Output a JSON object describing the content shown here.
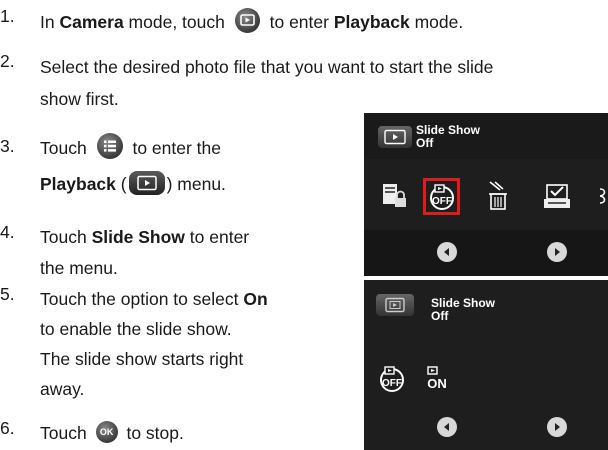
{
  "steps": [
    {
      "num": "1.",
      "pre": "In ",
      "b1": "Camera",
      "mid": " mode, touch",
      "post": "to enter ",
      "b2": "Playback",
      "end": " mode."
    },
    {
      "num": "2.",
      "line1": "Select the desired photo file that you want to start the slide",
      "line2": "show first."
    },
    {
      "num": "3.",
      "pre": "Touch",
      "post": "to enter the",
      "b1": "Playback",
      "paren_open": " (",
      "paren_close": ") menu."
    },
    {
      "num": "4.",
      "pre": "Touch ",
      "b1": "Slide Show",
      "post": " to enter",
      "line2": "the menu."
    },
    {
      "num": "5.",
      "pre": "Touch the option to select ",
      "b1": "On",
      "line2": "to enable the slide show.",
      "line3": "The slide show starts right",
      "line4": "away."
    },
    {
      "num": "6.",
      "pre": "Touch",
      "post": "to stop.",
      "ok_label": "OK"
    }
  ],
  "screen1": {
    "title": "Slide Show",
    "value": "Off",
    "selected_icon": "slideshow-off-icon",
    "icons": [
      "print-lock-icon",
      "slideshow-off-icon",
      "delete-icon",
      "dpof-icon"
    ]
  },
  "screen2": {
    "title": "Slide Show",
    "value": "Off",
    "options": [
      "slideshow-off-icon",
      "slideshow-on-icon"
    ]
  }
}
